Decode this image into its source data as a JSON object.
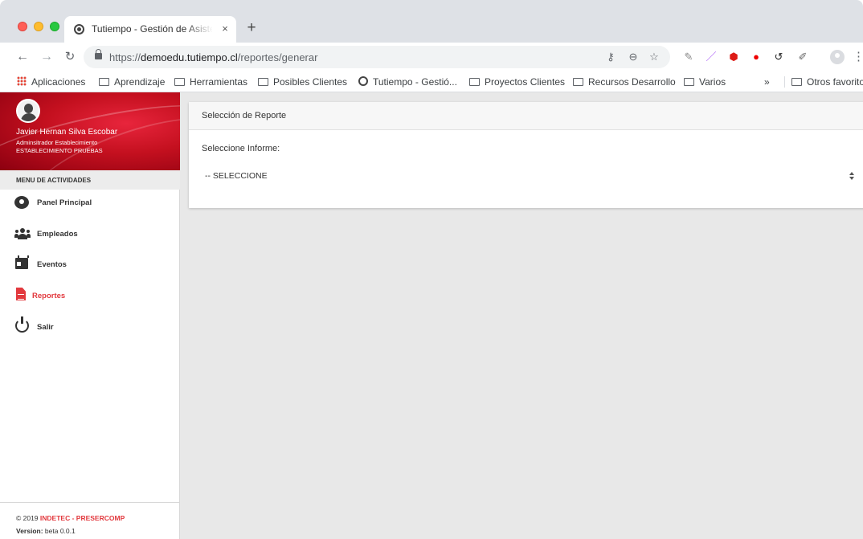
{
  "browser": {
    "tab_title": "Tutiempo - Gestión de Asistencia",
    "tab_close": "×",
    "new_tab": "+",
    "url_scheme": "https://",
    "url_host": "demoedu.tutiempo.cl",
    "url_path": "/reportes/generar",
    "bookmarks": [
      {
        "label": "Aplicaciones",
        "icon": "apps-icon"
      },
      {
        "label": "Aprendizaje",
        "icon": "folder-icon"
      },
      {
        "label": "Herramientas",
        "icon": "folder-icon"
      },
      {
        "label": "Posibles Clientes",
        "icon": "folder-icon"
      },
      {
        "label": "Tutiempo - Gestió...",
        "icon": "globe-icon"
      },
      {
        "label": "Proyectos Clientes",
        "icon": "folder-icon"
      },
      {
        "label": "Recursos Desarrollo",
        "icon": "folder-icon"
      },
      {
        "label": "Varios",
        "icon": "folder-icon"
      }
    ],
    "bookmarks_overflow": "»",
    "other_bookmarks": "Otros favoritos"
  },
  "user": {
    "name": "Javier Hernan Silva Escobar",
    "role": "Adminsitrador Establecimiento",
    "establishment": "ESTABLECIMIENTO PRUEBAS"
  },
  "sidebar": {
    "menu_title": "MENU DE ACTIVIDADES",
    "items": [
      {
        "label": "Panel Principal",
        "icon": "dashboard-gauge-icon",
        "active": false
      },
      {
        "label": "Empleados",
        "icon": "users-icon",
        "active": false
      },
      {
        "label": "Eventos",
        "icon": "calendar-icon",
        "active": false
      },
      {
        "label": "Reportes",
        "icon": "file-icon",
        "active": true
      },
      {
        "label": "Salir",
        "icon": "power-icon",
        "active": false
      }
    ],
    "footer": {
      "copyright_prefix": "© 2019",
      "brand": "INDETEC - PRESERCOMP",
      "version_label": "Version:",
      "version_value": "beta 0.0.1"
    }
  },
  "main": {
    "card_title": "Selección de Reporte",
    "field_label": "Seleccione Informe:",
    "select_value": "-- SELECCIONE"
  },
  "colors": {
    "accent": "#e2393e",
    "header_red": "#c4101f",
    "content_bg": "#e8e8e8"
  }
}
